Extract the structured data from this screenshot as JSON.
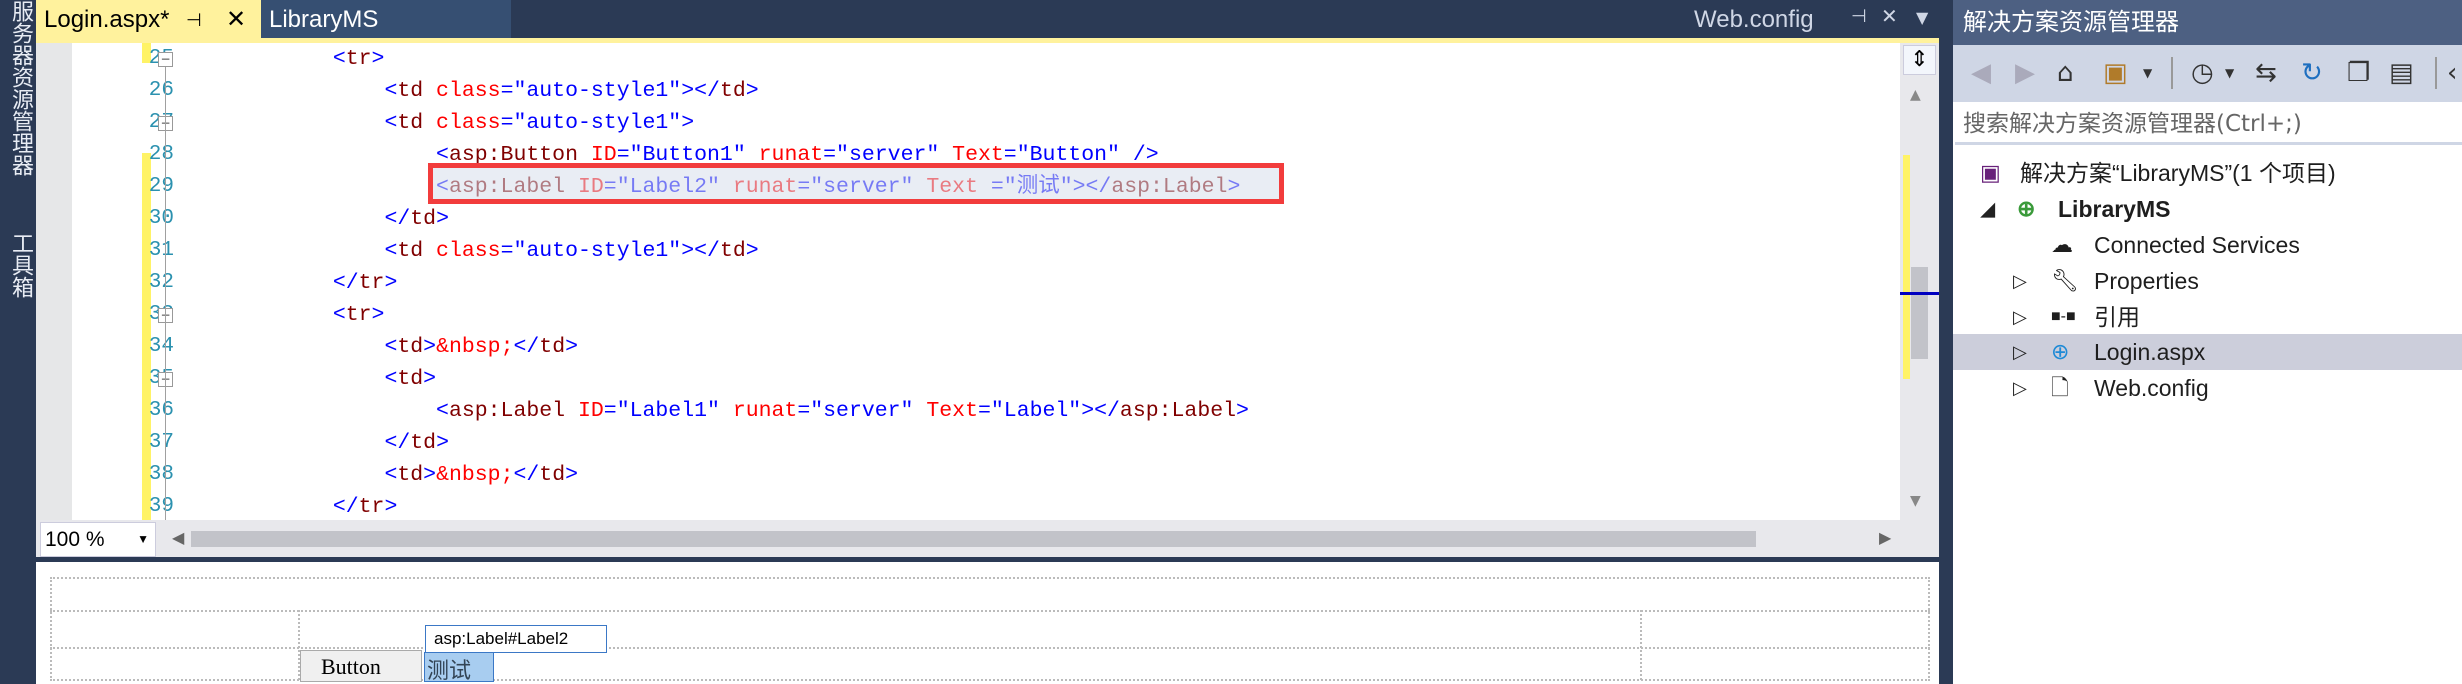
{
  "side_strip": {
    "server_explorer": "服务器资源管理器",
    "toolbox": "工具箱"
  },
  "tabs": [
    {
      "label": "Login.aspx*",
      "active": true
    },
    {
      "label": "LibraryMS"
    }
  ],
  "preview_tab": {
    "label": "Web.config"
  },
  "editor": {
    "zoom": "100 %",
    "lines": [
      {
        "num": "25",
        "tokens": [
          [
            "            ",
            "x"
          ],
          [
            "<",
            "d"
          ],
          [
            "tr",
            "n"
          ],
          [
            ">",
            "d"
          ]
        ]
      },
      {
        "num": "26",
        "tokens": [
          [
            "                ",
            "x"
          ],
          [
            "<",
            "d"
          ],
          [
            "td",
            "n"
          ],
          [
            " class",
            "a"
          ],
          [
            "=\"auto-style1\"",
            "v"
          ],
          [
            "></",
            "d"
          ],
          [
            "td",
            "n"
          ],
          [
            ">",
            "d"
          ]
        ]
      },
      {
        "num": "27",
        "tokens": [
          [
            "                ",
            "x"
          ],
          [
            "<",
            "d"
          ],
          [
            "td",
            "n"
          ],
          [
            " class",
            "a"
          ],
          [
            "=\"auto-style1\"",
            "v"
          ],
          [
            ">",
            "d"
          ]
        ]
      },
      {
        "num": "28",
        "tokens": [
          [
            "                    ",
            "x"
          ],
          [
            "<",
            "d"
          ],
          [
            "asp:Button",
            "n"
          ],
          [
            " ID",
            "a"
          ],
          [
            "=\"Button1\"",
            "v"
          ],
          [
            " runat",
            "a"
          ],
          [
            "=\"server\"",
            "v"
          ],
          [
            " Text",
            "a"
          ],
          [
            "=\"Button\"",
            "v"
          ],
          [
            " />",
            "d"
          ]
        ]
      },
      {
        "num": "29",
        "tokens": [
          [
            "                    ",
            "x"
          ],
          [
            "<",
            "d"
          ],
          [
            "asp:Label",
            "n"
          ],
          [
            " ID",
            "a"
          ],
          [
            "=\"Label2\"",
            "v"
          ],
          [
            " runat",
            "a"
          ],
          [
            "=\"server\"",
            "v"
          ],
          [
            " Text ",
            "a"
          ],
          [
            "=\"测试\"",
            "v"
          ],
          [
            "></",
            "d"
          ],
          [
            "asp:Label",
            "n"
          ],
          [
            ">",
            "d"
          ]
        ]
      },
      {
        "num": "30",
        "tokens": [
          [
            "                ",
            "x"
          ],
          [
            "</",
            "d"
          ],
          [
            "td",
            "n"
          ],
          [
            ">",
            "d"
          ]
        ]
      },
      {
        "num": "31",
        "tokens": [
          [
            "                ",
            "x"
          ],
          [
            "<",
            "d"
          ],
          [
            "td",
            "n"
          ],
          [
            " class",
            "a"
          ],
          [
            "=\"auto-style1\"",
            "v"
          ],
          [
            "></",
            "d"
          ],
          [
            "td",
            "n"
          ],
          [
            ">",
            "d"
          ]
        ]
      },
      {
        "num": "32",
        "tokens": [
          [
            "            ",
            "x"
          ],
          [
            "</",
            "d"
          ],
          [
            "tr",
            "n"
          ],
          [
            ">",
            "d"
          ]
        ]
      },
      {
        "num": "33",
        "tokens": [
          [
            "            ",
            "x"
          ],
          [
            "<",
            "d"
          ],
          [
            "tr",
            "n"
          ],
          [
            ">",
            "d"
          ]
        ]
      },
      {
        "num": "34",
        "tokens": [
          [
            "                ",
            "x"
          ],
          [
            "<",
            "d"
          ],
          [
            "td",
            "n"
          ],
          [
            ">",
            "d"
          ],
          [
            "&nbsp;",
            "a"
          ],
          [
            "</",
            "d"
          ],
          [
            "td",
            "n"
          ],
          [
            ">",
            "d"
          ]
        ]
      },
      {
        "num": "35",
        "tokens": [
          [
            "                ",
            "x"
          ],
          [
            "<",
            "d"
          ],
          [
            "td",
            "n"
          ],
          [
            ">",
            "d"
          ]
        ]
      },
      {
        "num": "36",
        "tokens": [
          [
            "                    ",
            "x"
          ],
          [
            "<",
            "d"
          ],
          [
            "asp:Label",
            "n"
          ],
          [
            " ID",
            "a"
          ],
          [
            "=\"Label1\"",
            "v"
          ],
          [
            " runat",
            "a"
          ],
          [
            "=\"server\"",
            "v"
          ],
          [
            " Text",
            "a"
          ],
          [
            "=\"Label\"",
            "v"
          ],
          [
            "></",
            "d"
          ],
          [
            "asp:Label",
            "n"
          ],
          [
            ">",
            "d"
          ]
        ]
      },
      {
        "num": "37",
        "tokens": [
          [
            "                ",
            "x"
          ],
          [
            "</",
            "d"
          ],
          [
            "td",
            "n"
          ],
          [
            ">",
            "d"
          ]
        ]
      },
      {
        "num": "38",
        "tokens": [
          [
            "                ",
            "x"
          ],
          [
            "<",
            "d"
          ],
          [
            "td",
            "n"
          ],
          [
            ">",
            "d"
          ],
          [
            "&nbsp;",
            "a"
          ],
          [
            "</",
            "d"
          ],
          [
            "td",
            "n"
          ],
          [
            ">",
            "d"
          ]
        ]
      },
      {
        "num": "39",
        "tokens": [
          [
            "            ",
            "x"
          ],
          [
            "</",
            "d"
          ],
          [
            "tr",
            "n"
          ],
          [
            ">",
            "d"
          ]
        ]
      }
    ]
  },
  "design": {
    "button_text": "Button",
    "label_text": "测试",
    "tooltip": "asp:Label#Label2"
  },
  "solution_explorer": {
    "title": "解决方案资源管理器",
    "search_placeholder": "搜索解决方案资源管理器(Ctrl+;)",
    "toolbar": [
      "back-icon",
      "forward-icon",
      "home-icon",
      "switch-views-icon",
      "history-icon",
      "sync-icon",
      "refresh-icon",
      "collapse-all-icon",
      "properties-icon"
    ],
    "tree": [
      {
        "label": "解决方案“LibraryMS”(1 个项目)",
        "icon": "solution-icon"
      },
      {
        "label": "LibraryMS",
        "icon": "web-project-icon",
        "expanded": true,
        "bold": true
      },
      {
        "label": "Connected Services",
        "icon": "cloud-plug-icon"
      },
      {
        "label": "Properties",
        "icon": "wrench-icon"
      },
      {
        "label": "引用",
        "icon": "references-icon"
      },
      {
        "label": "Login.aspx",
        "icon": "web-page-icon",
        "selected": true
      },
      {
        "label": "Web.config",
        "icon": "config-icon"
      }
    ]
  },
  "colors": {
    "accent_tab": "#fff29d",
    "chrome": "#2b3a55",
    "highlight_box": "#f23c3c",
    "selected_row": "#cccedb"
  }
}
